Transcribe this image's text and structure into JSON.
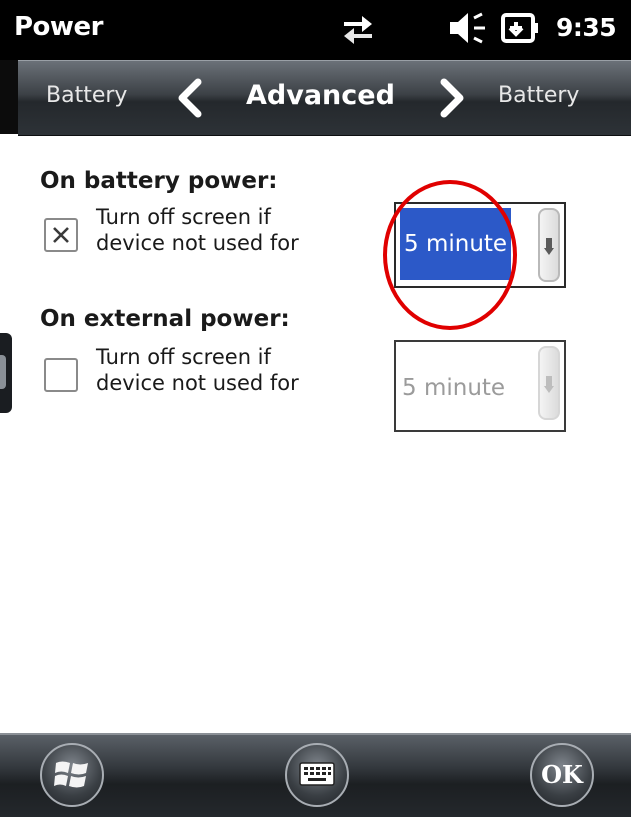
{
  "status_bar": {
    "title": "Power",
    "time": "9:35",
    "icons": [
      "sync-arrows-icon",
      "speaker-icon",
      "battery-plug-icon"
    ]
  },
  "nav": {
    "prev_label": "Battery",
    "current_label": "Advanced",
    "next_label": "Battery"
  },
  "battery_section": {
    "heading": "On battery power:",
    "checkbox_checked": true,
    "label_line1": "Turn off screen if",
    "label_line2": "device not used for",
    "dropdown_value": "5 minute",
    "dropdown_selected": true
  },
  "external_section": {
    "heading": "On external power:",
    "checkbox_checked": false,
    "label_line1": "Turn off screen if",
    "label_line2": "device not used for",
    "dropdown_value": "5 minute",
    "dropdown_disabled": true
  },
  "softkeys": {
    "start_icon": "windows-logo-icon",
    "keyboard_icon": "keyboard-icon",
    "ok_label": "OK"
  },
  "colors": {
    "selection_blue": "#2c59c8",
    "annotation_red": "#e00000"
  }
}
